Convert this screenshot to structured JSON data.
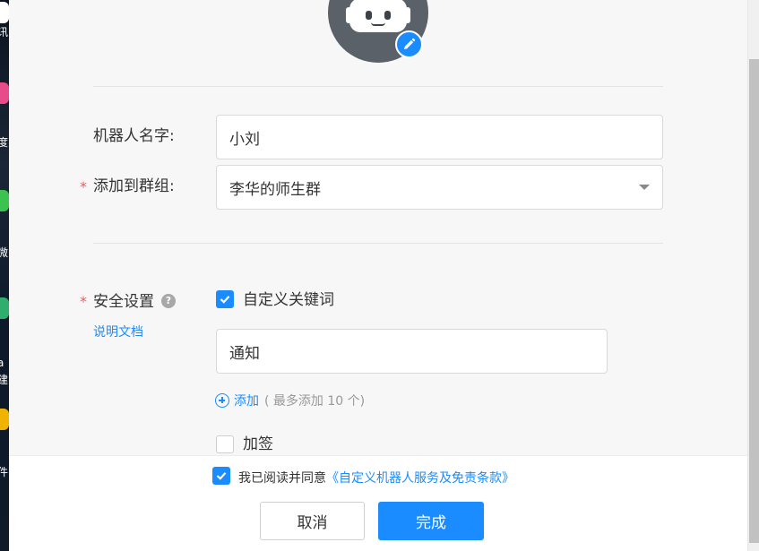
{
  "colors": {
    "accent": "#1a8cff",
    "required": "#f25b5b",
    "avatar_bg": "#5b6168"
  },
  "desktop_strip": {
    "fragments": [
      "讯",
      "度",
      "微",
      "a",
      "建",
      "件"
    ]
  },
  "avatar": {
    "icon": "robot-icon",
    "edit_icon": "pencil-icon"
  },
  "form": {
    "name_label": "机器人名字:",
    "name_value": "小刘",
    "group_required": "*",
    "group_label": "添加到群组:",
    "group_value": "李华的师生群",
    "group_caret_icon": "caret-down-icon"
  },
  "security": {
    "required": "*",
    "label": "安全设置",
    "help_icon": "question-circle-icon",
    "help_glyph": "?",
    "doc_link": "说明文档",
    "custom_keyword": {
      "label": "自定义关键词",
      "checked": true
    },
    "keyword_value": "通知",
    "add_label": "添加",
    "add_hint": "( 最多添加 10 个)",
    "sign": {
      "label": "加签",
      "checked": false
    }
  },
  "footer": {
    "agree_checked": true,
    "agree_text": "我已阅读并同意",
    "agree_link": "《自定义机器人服务及免责条款》",
    "cancel_label": "取消",
    "done_label": "完成"
  }
}
